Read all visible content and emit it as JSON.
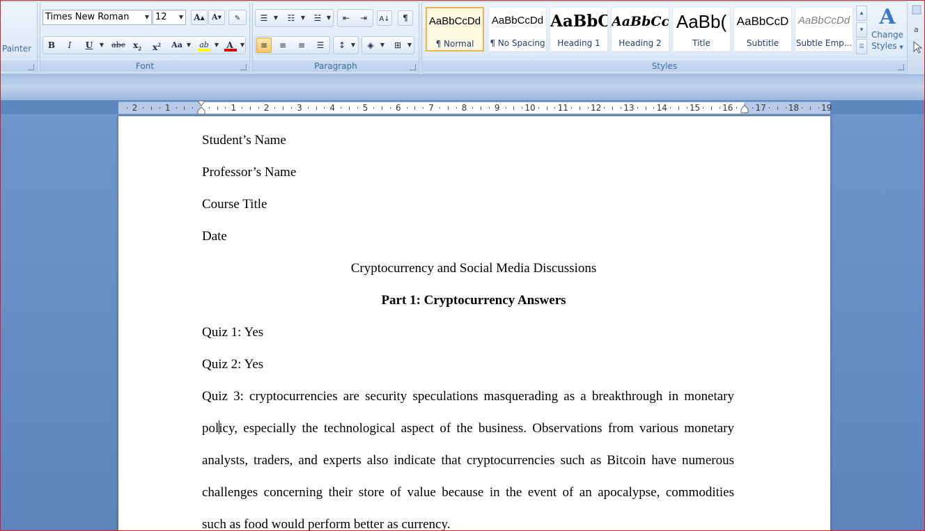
{
  "clipboard": {
    "painter_label": "Painter"
  },
  "font": {
    "family": "Times New Roman",
    "size": "12",
    "group_label": "Font",
    "grow_glyph": "A",
    "shrink_glyph": "A",
    "bold": "B",
    "italic": "I",
    "underline": "U",
    "strike": "abc",
    "subscript": "x",
    "superscript": "x",
    "change_case": "Aa",
    "highlight_glyph": "ab",
    "font_color_glyph": "A",
    "highlight_color": "#ffff00",
    "font_color": "#e00000"
  },
  "paragraph": {
    "group_label": "Paragraph",
    "pilcrow": "¶"
  },
  "styles": {
    "group_label": "Styles",
    "items": [
      {
        "sample": "AaBbCcDd",
        "name": "¶ Normal"
      },
      {
        "sample": "AaBbCcDd",
        "name": "¶ No Spacing"
      },
      {
        "sample": "AaBbC",
        "name": "Heading 1"
      },
      {
        "sample": "AaBbCc",
        "name": "Heading 2"
      },
      {
        "sample": "AaBb(",
        "name": "Title"
      },
      {
        "sample": "AaBbCcD",
        "name": "Subtitle"
      },
      {
        "sample": "AaBbCcDd",
        "name": "Subtle Emp..."
      }
    ],
    "change_styles_glyph": "A",
    "change_styles_line1": "Change",
    "change_styles_line2": "Styles"
  },
  "ruler": {
    "neg": [
      "2",
      "1"
    ],
    "pos": [
      "1",
      "2",
      "3",
      "4",
      "5",
      "6",
      "7",
      "8",
      "9",
      "10",
      "11",
      "12",
      "13",
      "14",
      "15",
      "16",
      "17",
      "18",
      "19"
    ]
  },
  "document": {
    "student_name": "Student’s Name",
    "professor_name": "Professor’s Name",
    "course_title": "Course Title",
    "date": "Date",
    "title": "Cryptocurrency and Social Media Discussions",
    "part_heading": "Part 1: Cryptocurrency  Answers",
    "quiz1": "Quiz 1: Yes",
    "quiz2": "Quiz 2: Yes",
    "quiz3_line1": "Quiz 3: cryptocurrencies are security speculations masquerading as a breakthrough in monetary",
    "quiz3_line2_before_caret": "pol",
    "quiz3_line2_after_caret": "icy, especially the technological aspect of the business. Observations from various monetary",
    "quiz3_line3": "analysts, traders, and experts also indicate that cryptocurrencies such as Bitcoin have numerous",
    "quiz3_line4": "challenges concerning their store of value because in the event of an apocalypse, commodities",
    "quiz3_line5": "such as food would perform better as currency."
  }
}
